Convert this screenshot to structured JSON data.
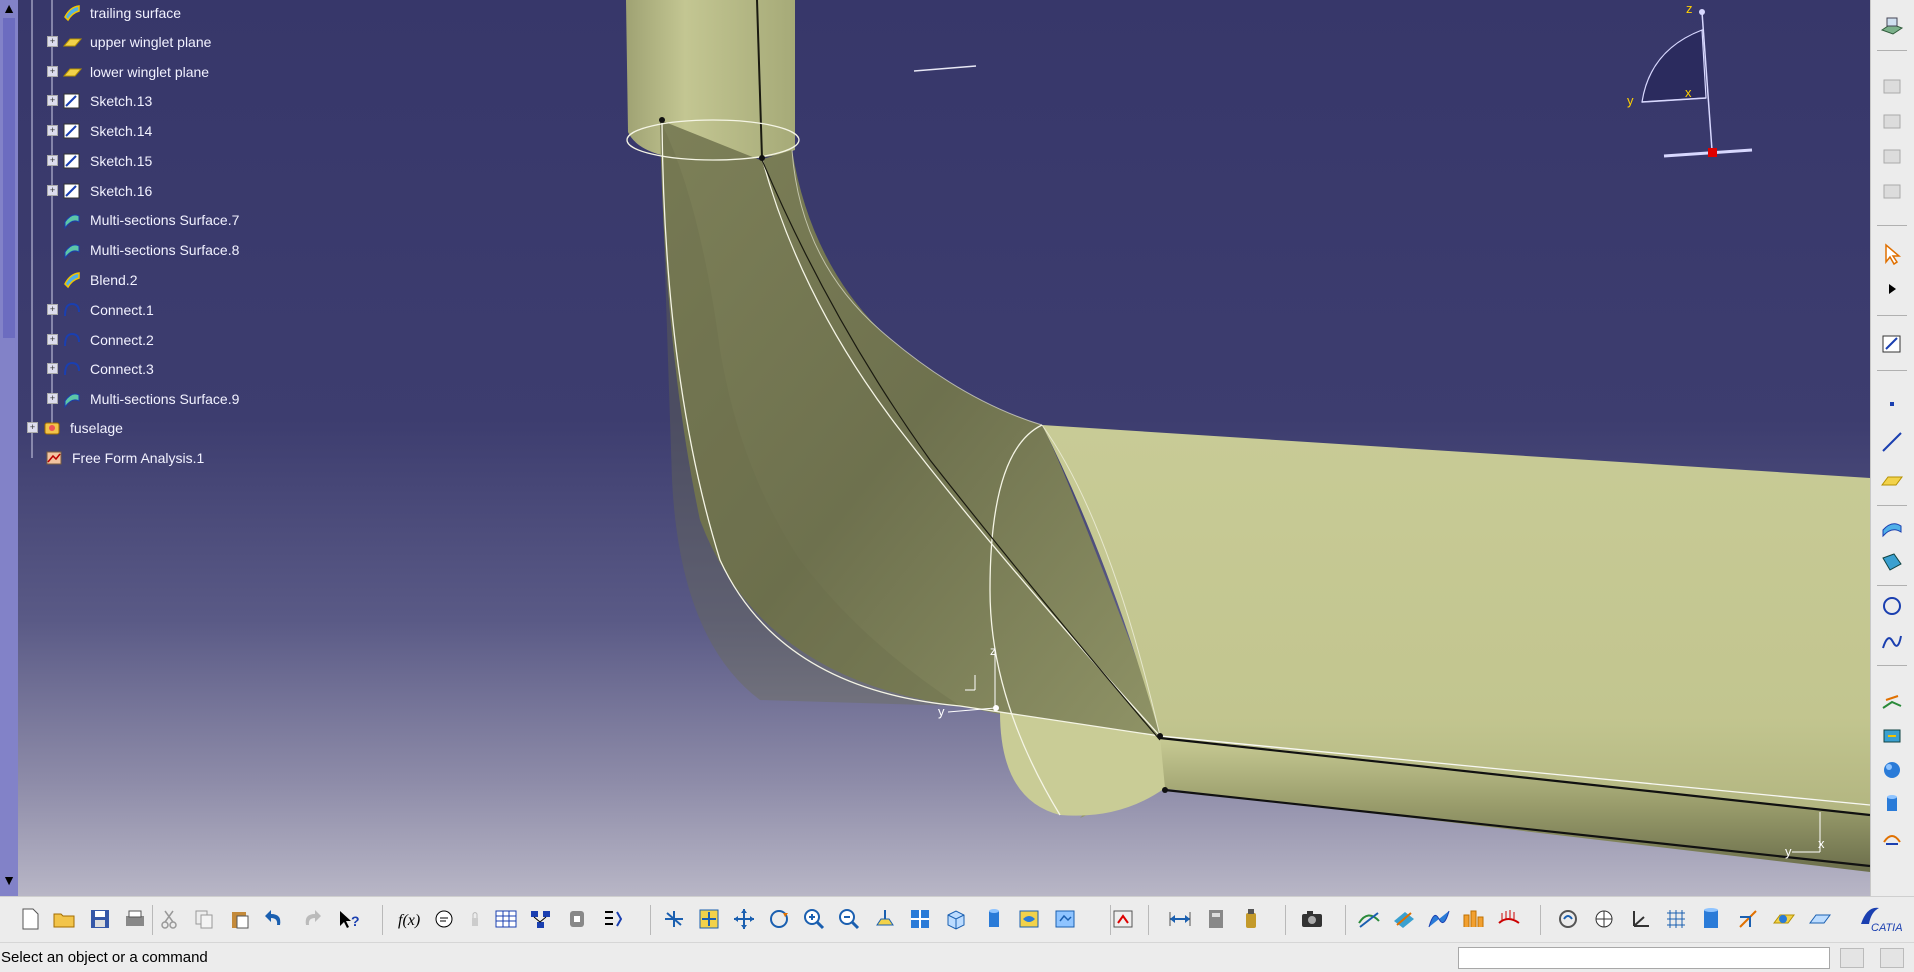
{
  "tree": {
    "items": [
      {
        "label": "trailing surface",
        "icon": "surface-icon"
      },
      {
        "label": "upper winglet plane",
        "icon": "plane-icon"
      },
      {
        "label": "lower winglet plane",
        "icon": "plane-icon"
      },
      {
        "label": "Sketch.13",
        "icon": "sketch-icon"
      },
      {
        "label": "Sketch.14",
        "icon": "sketch-icon"
      },
      {
        "label": "Sketch.15",
        "icon": "sketch-icon"
      },
      {
        "label": "Sketch.16",
        "icon": "sketch-icon"
      },
      {
        "label": "Multi-sections Surface.7",
        "icon": "multi-sections-surface-icon"
      },
      {
        "label": "Multi-sections Surface.8",
        "icon": "multi-sections-surface-icon"
      },
      {
        "label": "Blend.2",
        "icon": "blend-icon"
      },
      {
        "label": "Connect.1",
        "icon": "connect-curve-icon"
      },
      {
        "label": "Connect.2",
        "icon": "connect-curve-icon"
      },
      {
        "label": "Connect.3",
        "icon": "connect-curve-icon"
      },
      {
        "label": "Multi-sections Surface.9",
        "icon": "multi-sections-surface-icon"
      },
      {
        "label": "fuselage",
        "icon": "geometrical-set-icon"
      },
      {
        "label": "Free Form Analysis.1",
        "icon": "analysis-icon"
      }
    ]
  },
  "compass": {
    "z_label": "z",
    "y_label": "y",
    "x_label": "x"
  },
  "local_axis_center": {
    "z_label": "z",
    "y_label": "y"
  },
  "local_axis_right": {
    "y_label": "y",
    "x_label": "x"
  },
  "status": {
    "message": "Select an object or a command"
  },
  "colors": {
    "background_top": "#37376a",
    "background_bottom": "#b8b6c6",
    "surface": "#c5c993",
    "surface_shadow": "#6f7250",
    "tree_text": "#f2f2ff"
  }
}
